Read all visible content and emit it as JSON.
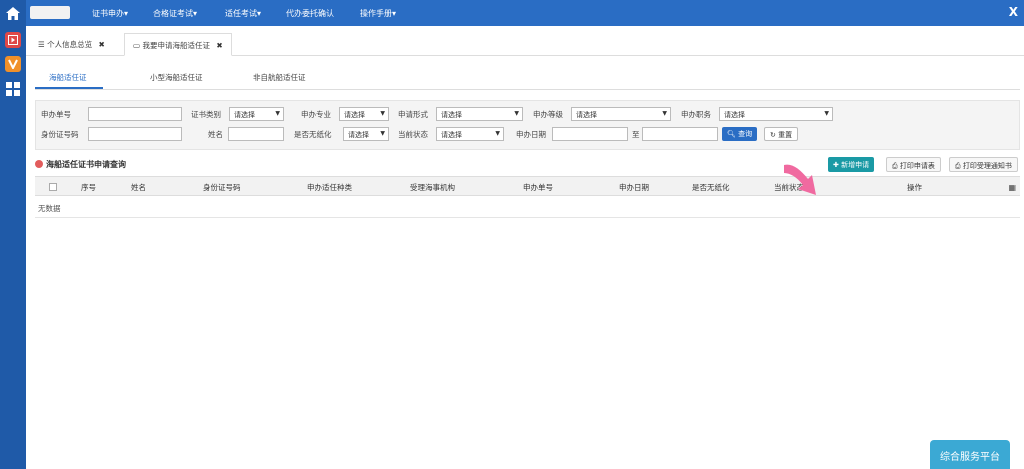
{
  "topnav": {
    "items": [
      "证书申办▾",
      "合格证考试▾",
      "适任考试▾",
      "代办委托确认",
      "操作手册▾"
    ],
    "close_glyph": "X"
  },
  "icons": {
    "home": "home-icon",
    "sidebar": [
      "video-icon",
      "v-icon",
      "grid-icon"
    ],
    "list": "list-icon",
    "card": "card-icon",
    "search": "search-icon",
    "refresh": "refresh-icon",
    "plus": "plus-icon",
    "print": "print-icon",
    "columns": "columns-icon"
  },
  "page_tabs": [
    {
      "label": "个人信息总览",
      "close": "✖"
    },
    {
      "label": "我要申请海船适任证",
      "close": "✖"
    }
  ],
  "sub_tabs": [
    "海船适任证",
    "小型海船适任证",
    "非自航船适任证"
  ],
  "filter": {
    "row1": {
      "apply_no_label": "申办单号",
      "cert_type_label": "证书类别",
      "major_label": "申办专业",
      "form_label": "申请形式",
      "level_label": "申办等级",
      "position_label": "申办职务"
    },
    "row2": {
      "id_label": "身份证号码",
      "name_label": "姓名",
      "paperless_label": "是否无纸化",
      "status_label": "当前状态",
      "date_label": "申办日期",
      "to_label": "至"
    },
    "select_placeholder": "请选择",
    "query_button": "查询",
    "reset_button": "重置"
  },
  "grid": {
    "title": "海船适任证书申请查询",
    "add_button": "新增申请",
    "print_button": "打印申请表",
    "print_notice_button": "打印受理通知书",
    "columns": [
      "序号",
      "姓名",
      "身份证号码",
      "申办适任种类",
      "受理海事机构",
      "申办单号",
      "申办日期",
      "是否无纸化",
      "当前状态",
      "操作"
    ],
    "empty_text": "无数据"
  },
  "platform_button": "综合服务平台",
  "colors": {
    "nav": "#2a6dc4",
    "sidebar": "#1f5aa8",
    "add_button": "#1a9aa5",
    "arrow": "#f06aa0",
    "platform": "#3ba9d4"
  }
}
